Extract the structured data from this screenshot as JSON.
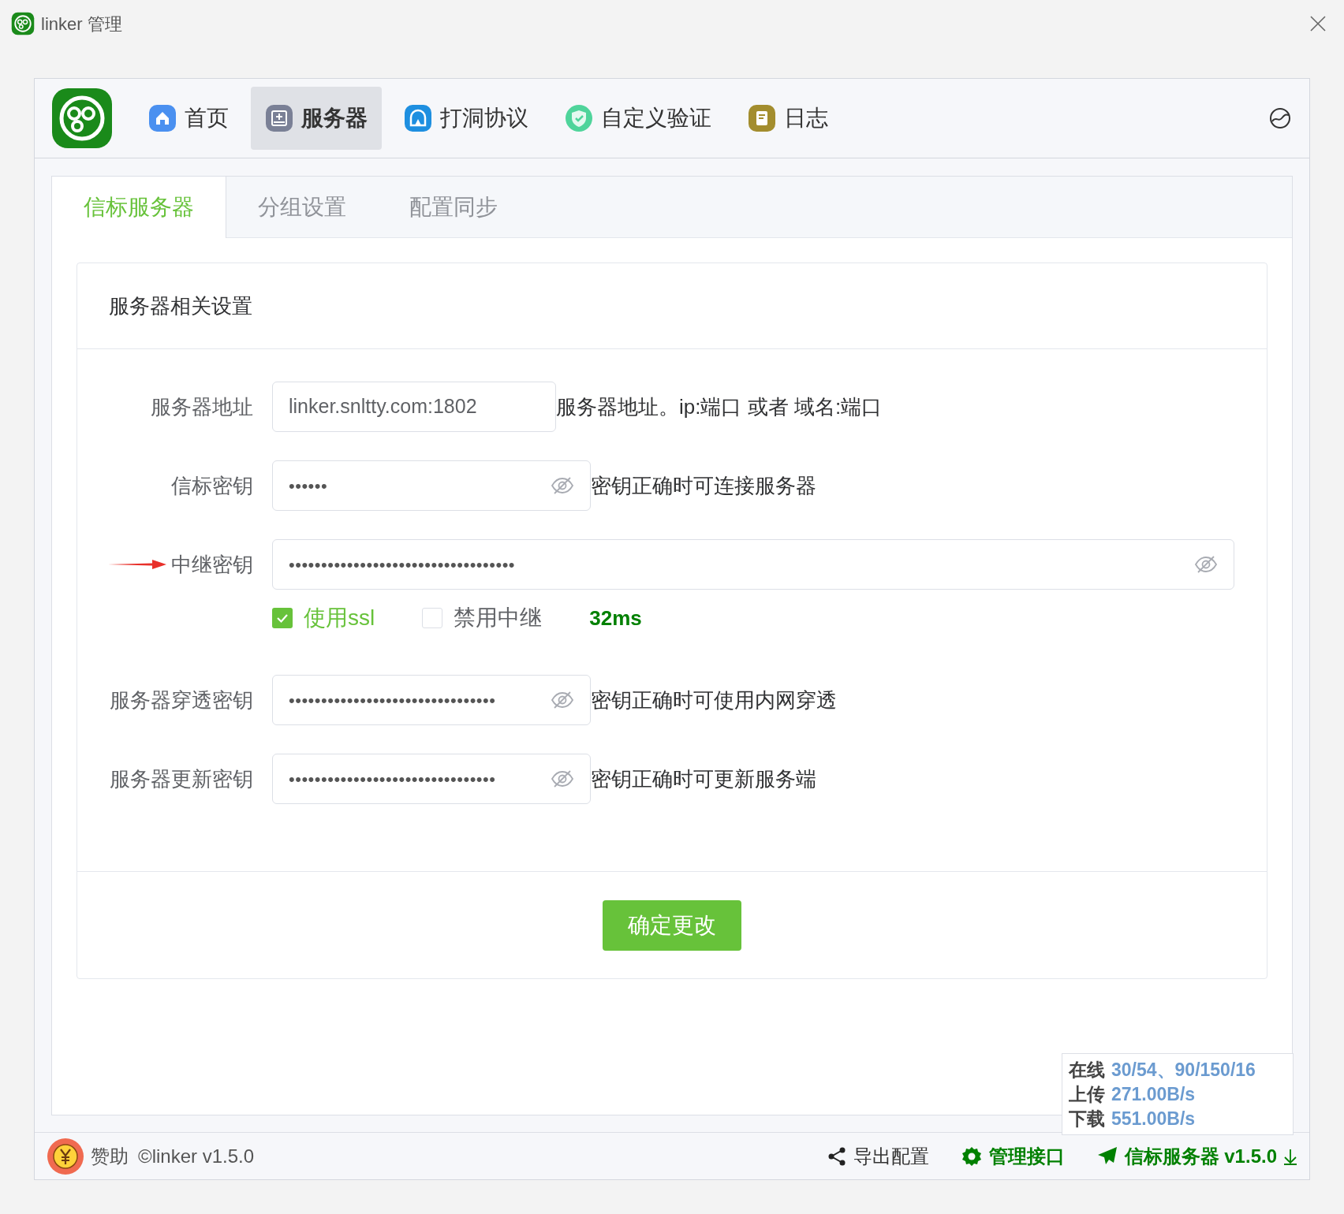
{
  "window": {
    "title": "linker 管理"
  },
  "nav": {
    "items": [
      {
        "label": "首页",
        "kind": "home",
        "color": "#4a90f0",
        "selected": false
      },
      {
        "label": "服务器",
        "kind": "server",
        "color": "#7a8096",
        "selected": true
      },
      {
        "label": "打洞协议",
        "kind": "hole",
        "color": "#1e8fe0",
        "selected": false
      },
      {
        "label": "自定义验证",
        "kind": "shield",
        "color": "#4fd49b",
        "selected": false
      },
      {
        "label": "日志",
        "kind": "log",
        "color": "#a38d2e",
        "selected": false
      }
    ]
  },
  "tabs": [
    {
      "label": "信标服务器",
      "selected": true
    },
    {
      "label": "分组设置",
      "selected": false
    },
    {
      "label": "配置同步",
      "selected": false
    }
  ],
  "card": {
    "title": "服务器相关设置",
    "fields": [
      {
        "label": "服务器地址",
        "kind": "text",
        "value": "linker.snltty.com:1802",
        "hint": "服务器地址。ip:端口 或者 域名:端口",
        "marked": false
      },
      {
        "label": "信标密钥",
        "kind": "secret",
        "value": "••••••",
        "hint": "密钥正确时可连接服务器",
        "marked": false
      },
      {
        "label": "中继密钥",
        "kind": "secret",
        "value": "•••••••••••••••••••••••••••••••••••",
        "marked": true
      },
      {
        "label": "服务器穿透密钥",
        "kind": "secret",
        "value": "••••••••••••••••••••••••••••••••",
        "hint": "密钥正确时可使用内网穿透",
        "marked": false
      },
      {
        "label": "服务器更新密钥",
        "kind": "secret",
        "value": "••••••••••••••••••••••••••••••••",
        "hint": "密钥正确时可更新服务端",
        "marked": false
      }
    ],
    "options": [
      {
        "label": "使用ssl",
        "checked": true
      },
      {
        "label": "禁用中继",
        "checked": false
      }
    ],
    "latency": "32ms",
    "submit": "确定更改"
  },
  "status": [
    {
      "label": "在线",
      "value": "30/54、90/150/16"
    },
    {
      "label": "上传",
      "value": "271.00B/s"
    },
    {
      "label": "下载",
      "value": "551.00B/s"
    }
  ],
  "footer": {
    "sponsor": "赞助",
    "copyright": "©linker v1.5.0",
    "actions": [
      {
        "label": "导出配置",
        "kind": "share"
      },
      {
        "label": "管理接口",
        "kind": "gear"
      },
      {
        "label": "信标服务器 v1.5.0",
        "kind": "send"
      }
    ]
  }
}
